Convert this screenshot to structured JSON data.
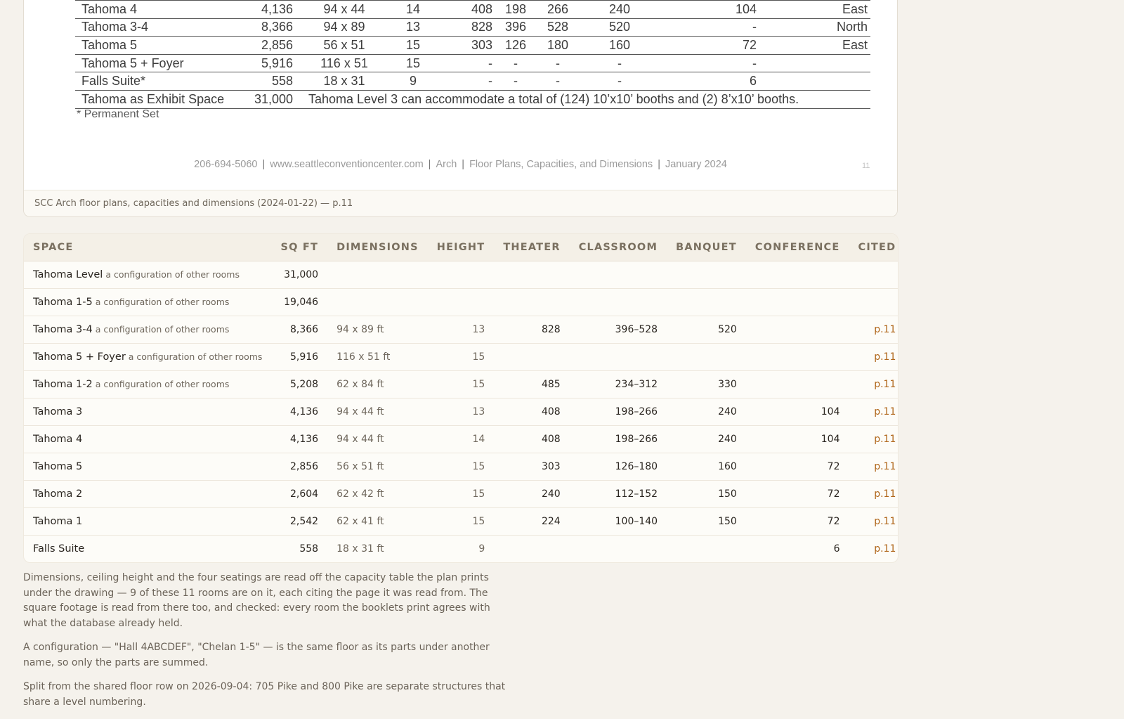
{
  "doc_excerpt": {
    "rows": [
      {
        "name": "Tahoma 4",
        "sqft": "4,136",
        "dims": "94 x 44",
        "height": "14",
        "theater": "408",
        "class_a": "198",
        "class_b": "266",
        "banquet": "240",
        "conference": "104",
        "orientation": "East"
      },
      {
        "name": "Tahoma 3-4",
        "sqft": "8,366",
        "dims": "94 x 89",
        "height": "13",
        "theater": "828",
        "class_a": "396",
        "class_b": "528",
        "banquet": "520",
        "conference": "-",
        "orientation": "North"
      },
      {
        "name": "Tahoma 5",
        "sqft": "2,856",
        "dims": "56 x 51",
        "height": "15",
        "theater": "303",
        "class_a": "126",
        "class_b": "180",
        "banquet": "160",
        "conference": "72",
        "orientation": "East"
      },
      {
        "name": "Tahoma 5 + Foyer",
        "sqft": "5,916",
        "dims": "116 x 51",
        "height": "15",
        "theater": "-",
        "class_a": "-",
        "class_b": "-",
        "banquet": "-",
        "conference": "-",
        "orientation": ""
      },
      {
        "name": "Falls Suite*",
        "sqft": "558",
        "dims": "18 x 31",
        "height": "9",
        "theater": "-",
        "class_a": "-",
        "class_b": "-",
        "banquet": "-",
        "conference": "6",
        "orientation": ""
      }
    ],
    "exhibit_row": {
      "name": "Tahoma as Exhibit Space",
      "sqft": "31,000",
      "note": "Tahoma Level 3 can accommodate a total of (124) 10’x10’ booths and (2) 8’x10’ booths."
    },
    "footnote": "* Permanent Set",
    "footer": {
      "phone": "206-694-5060",
      "website": "www.seattleconventioncenter.com",
      "building": "Arch",
      "title": "Floor Plans, Capacities, and Dimensions",
      "date": "January 2024",
      "page": "11"
    },
    "caption": "SCC Arch floor plans, capacities and dimensions (2024-01-22) — p.11"
  },
  "rooms_table": {
    "headers": {
      "space": "SPACE",
      "sqft": "SQ FT",
      "dimensions": "DIMENSIONS",
      "height": "HEIGHT",
      "theater": "THEATER",
      "classroom": "CLASSROOM",
      "banquet": "BANQUET",
      "conference": "CONFERENCE",
      "cited": "CITED"
    },
    "rows": [
      {
        "name": "Tahoma Level",
        "config": "a configuration of other rooms",
        "sqft": "31,000",
        "dims": "",
        "height": "",
        "theater": "",
        "classroom": "",
        "banquet": "",
        "conference": "",
        "cited": ""
      },
      {
        "name": "Tahoma 1-5",
        "config": "a configuration of other rooms",
        "sqft": "19,046",
        "dims": "",
        "height": "",
        "theater": "",
        "classroom": "",
        "banquet": "",
        "conference": "",
        "cited": ""
      },
      {
        "name": "Tahoma 3-4",
        "config": "a configuration of other rooms",
        "sqft": "8,366",
        "dims": "94 x 89 ft",
        "height": "13",
        "theater": "828",
        "classroom": "396–528",
        "banquet": "520",
        "conference": "",
        "cited": "p.11"
      },
      {
        "name": "Tahoma 5 + Foyer",
        "config": "a configuration of other rooms",
        "sqft": "5,916",
        "dims": "116 x 51 ft",
        "height": "15",
        "theater": "",
        "classroom": "",
        "banquet": "",
        "conference": "",
        "cited": "p.11"
      },
      {
        "name": "Tahoma 1-2",
        "config": "a configuration of other rooms",
        "sqft": "5,208",
        "dims": "62 x 84 ft",
        "height": "15",
        "theater": "485",
        "classroom": "234–312",
        "banquet": "330",
        "conference": "",
        "cited": "p.11"
      },
      {
        "name": "Tahoma 3",
        "config": "",
        "sqft": "4,136",
        "dims": "94 x 44 ft",
        "height": "13",
        "theater": "408",
        "classroom": "198–266",
        "banquet": "240",
        "conference": "104",
        "cited": "p.11"
      },
      {
        "name": "Tahoma 4",
        "config": "",
        "sqft": "4,136",
        "dims": "94 x 44 ft",
        "height": "14",
        "theater": "408",
        "classroom": "198–266",
        "banquet": "240",
        "conference": "104",
        "cited": "p.11"
      },
      {
        "name": "Tahoma 5",
        "config": "",
        "sqft": "2,856",
        "dims": "56 x 51 ft",
        "height": "15",
        "theater": "303",
        "classroom": "126–180",
        "banquet": "160",
        "conference": "72",
        "cited": "p.11"
      },
      {
        "name": "Tahoma 2",
        "config": "",
        "sqft": "2,604",
        "dims": "62 x 42 ft",
        "height": "15",
        "theater": "240",
        "classroom": "112–152",
        "banquet": "150",
        "conference": "72",
        "cited": "p.11"
      },
      {
        "name": "Tahoma 1",
        "config": "",
        "sqft": "2,542",
        "dims": "62 x 41 ft",
        "height": "15",
        "theater": "224",
        "classroom": "100–140",
        "banquet": "150",
        "conference": "72",
        "cited": "p.11"
      },
      {
        "name": "Falls Suite",
        "config": "",
        "sqft": "558",
        "dims": "18 x 31 ft",
        "height": "9",
        "theater": "",
        "classroom": "",
        "banquet": "",
        "conference": "6",
        "cited": "p.11"
      }
    ]
  },
  "notes": [
    "Dimensions, ceiling height and the four seatings are read off the capacity table the plan prints under the drawing — 9 of these 11 rooms are on it, each citing the page it was read from. The square footage is read from there too, and checked: every room the booklets print agrees with what the database already held.",
    "A configuration — \"Hall 4ABCDEF\", \"Chelan 1-5\" — is the same floor as its parts under another name, so only the parts are summed.",
    "Split from the shared floor row on 2026-09-04: 705 Pike and 800 Pike are separate structures that share a level numbering."
  ]
}
